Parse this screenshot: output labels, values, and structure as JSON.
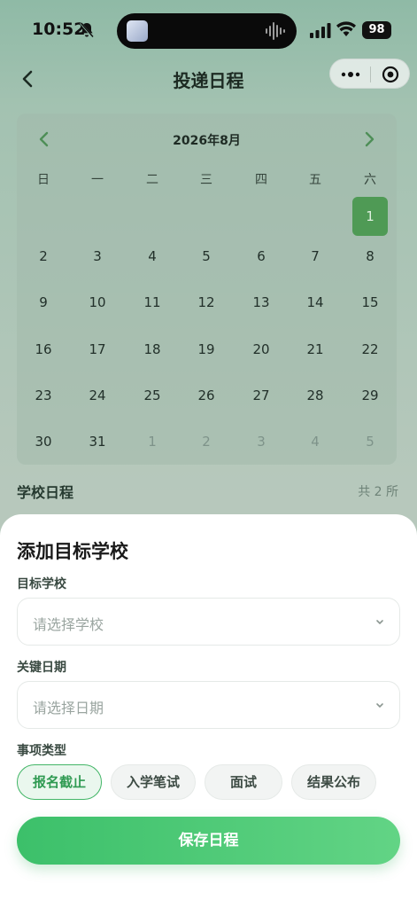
{
  "status_bar": {
    "time": "10:52",
    "battery": "98"
  },
  "nav": {
    "title": "投递日程"
  },
  "calendar": {
    "month_label": "2026年8月",
    "weekdays": [
      "日",
      "一",
      "二",
      "三",
      "四",
      "五",
      "六"
    ],
    "weeks": [
      [
        "",
        "",
        "",
        "",
        "",
        "",
        "1"
      ],
      [
        "2",
        "3",
        "4",
        "5",
        "6",
        "7",
        "8"
      ],
      [
        "9",
        "10",
        "11",
        "12",
        "13",
        "14",
        "15"
      ],
      [
        "16",
        "17",
        "18",
        "19",
        "20",
        "21",
        "22"
      ],
      [
        "23",
        "24",
        "25",
        "26",
        "27",
        "28",
        "29"
      ],
      [
        "30",
        "31",
        "1",
        "2",
        "3",
        "4",
        "5"
      ]
    ],
    "selected_day": "1"
  },
  "schedule": {
    "title": "学校日程",
    "count": "共 2 所"
  },
  "sheet": {
    "title": "添加目标学校",
    "school_label": "目标学校",
    "school_placeholder": "请选择学校",
    "date_label": "关键日期",
    "date_placeholder": "请选择日期",
    "type_label": "事项类型",
    "types": [
      {
        "label": "报名截止",
        "active": true
      },
      {
        "label": "入学笔试",
        "active": false
      },
      {
        "label": "面试",
        "active": false
      },
      {
        "label": "结果公布",
        "active": false
      }
    ],
    "save_label": "保存日程"
  },
  "colors": {
    "accent": "#43b667",
    "selected_day": "#4f9a55"
  }
}
